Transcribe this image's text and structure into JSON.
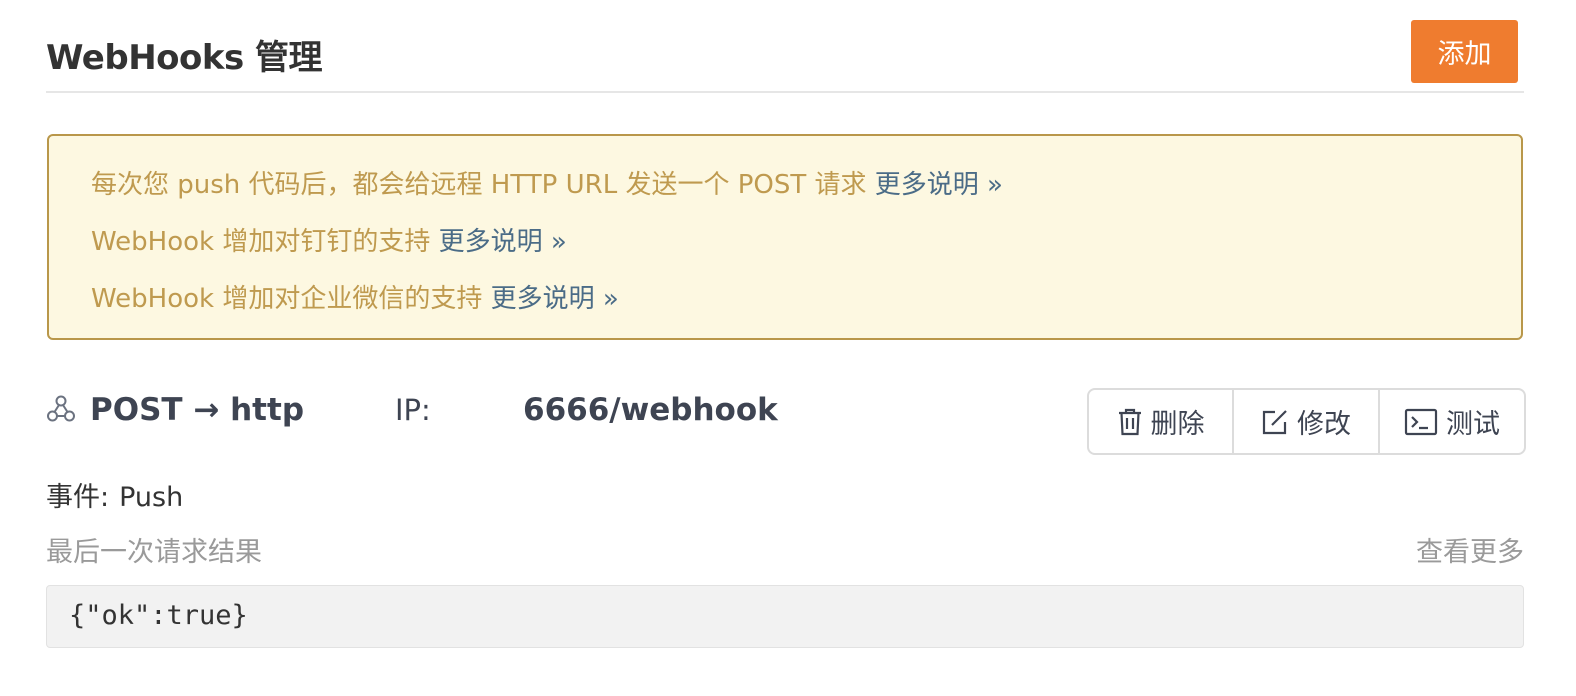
{
  "header": {
    "title": "WebHooks 管理",
    "add_label": "添加"
  },
  "notice": {
    "lines": [
      {
        "text": "每次您 push 代码后，都会给远程 HTTP URL 发送一个 POST 请求 ",
        "more": "更多说明 »"
      },
      {
        "text": "WebHook 增加对钉钉的支持 ",
        "more": "更多说明 »"
      },
      {
        "text": "WebHook 增加对企业微信的支持 ",
        "more": "更多说明 »"
      }
    ]
  },
  "webhook": {
    "url_prefix": "POST → http://",
    "ip_label": "IP:",
    "url_suffix": "6666/webhook",
    "actions": {
      "delete": "删除",
      "edit": "修改",
      "test": "测试"
    },
    "event_label": "事件:",
    "event_value": "Push",
    "last_result_label": "最后一次请求结果",
    "view_more": "查看更多",
    "last_result": "{\"ok\":true}"
  },
  "colors": {
    "accent": "#ef7c2f",
    "notice_bg": "#fdf8e1",
    "notice_text": "#bf9a4f",
    "link": "#4b6c87"
  }
}
